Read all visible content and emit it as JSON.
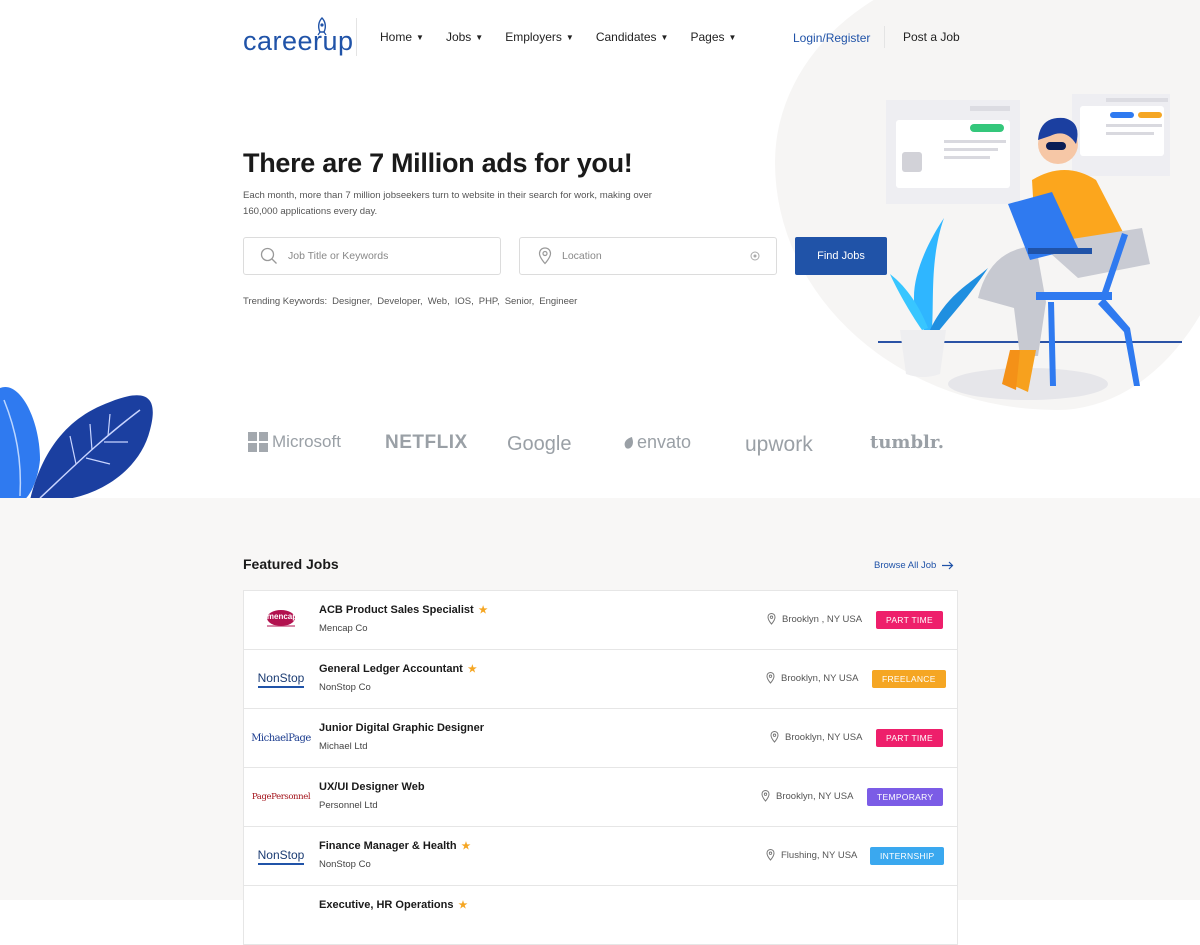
{
  "header": {
    "logo": "careerup",
    "nav": [
      {
        "label": "Home"
      },
      {
        "label": "Jobs"
      },
      {
        "label": "Employers"
      },
      {
        "label": "Candidates"
      },
      {
        "label": "Pages"
      }
    ],
    "login": "Login/Register",
    "post_job": "Post a Job"
  },
  "hero": {
    "title": "There are 7 Million ads for you!",
    "subtitle": "Each month, more than 7 million jobseekers turn to website in their search for work, making over 160,000 applications every day.",
    "search": {
      "keyword_placeholder": "Job Title or Keywords",
      "location_placeholder": "Location",
      "button": "Find Jobs"
    },
    "trending": {
      "label": "Trending Keywords:",
      "keywords": [
        "Designer,",
        "Developer,",
        "Web,",
        "IOS,",
        "PHP,",
        "Senior,",
        "Engineer"
      ]
    }
  },
  "brands": [
    "Microsoft",
    "NETFLIX",
    "Google",
    "envato",
    "upwork",
    "tumblr."
  ],
  "featured": {
    "title": "Featured Jobs",
    "browse": "Browse All Job",
    "jobs": [
      {
        "title": "ACB Product Sales Specialist",
        "company": "Mencap Co",
        "logo": "mencap",
        "location": "Brooklyn , NY USA",
        "type": "PART TIME",
        "color": "#ee1f6b",
        "featured": true
      },
      {
        "title": "General Ledger Accountant",
        "company": "NonStop Co",
        "logo": "NonStop",
        "location": "Brooklyn, NY USA",
        "type": "FREELANCE",
        "color": "#f5a623",
        "featured": true
      },
      {
        "title": "Junior Digital Graphic Designer",
        "company": "Michael Ltd",
        "logo": "MichaelPage",
        "location": "Brooklyn, NY USA",
        "type": "PART TIME",
        "color": "#ee1f6b",
        "featured": false
      },
      {
        "title": "UX/UI Designer Web",
        "company": "Personnel Ltd",
        "logo": "PagePersonnel",
        "location": "Brooklyn, NY USA",
        "type": "TEMPORARY",
        "color": "#7b5ce6",
        "featured": false
      },
      {
        "title": "Finance Manager & Health",
        "company": "NonStop Co",
        "logo": "NonStop",
        "location": "Flushing, NY USA",
        "type": "INTERNSHIP",
        "color": "#3aa8ef",
        "featured": true
      },
      {
        "title": "Executive, HR Operations",
        "company": "",
        "logo": "",
        "location": "",
        "type": "",
        "color": "#ee1f6b",
        "featured": true
      }
    ]
  },
  "colors": {
    "primary": "#2053a8",
    "accent_star": "#f5a623"
  }
}
